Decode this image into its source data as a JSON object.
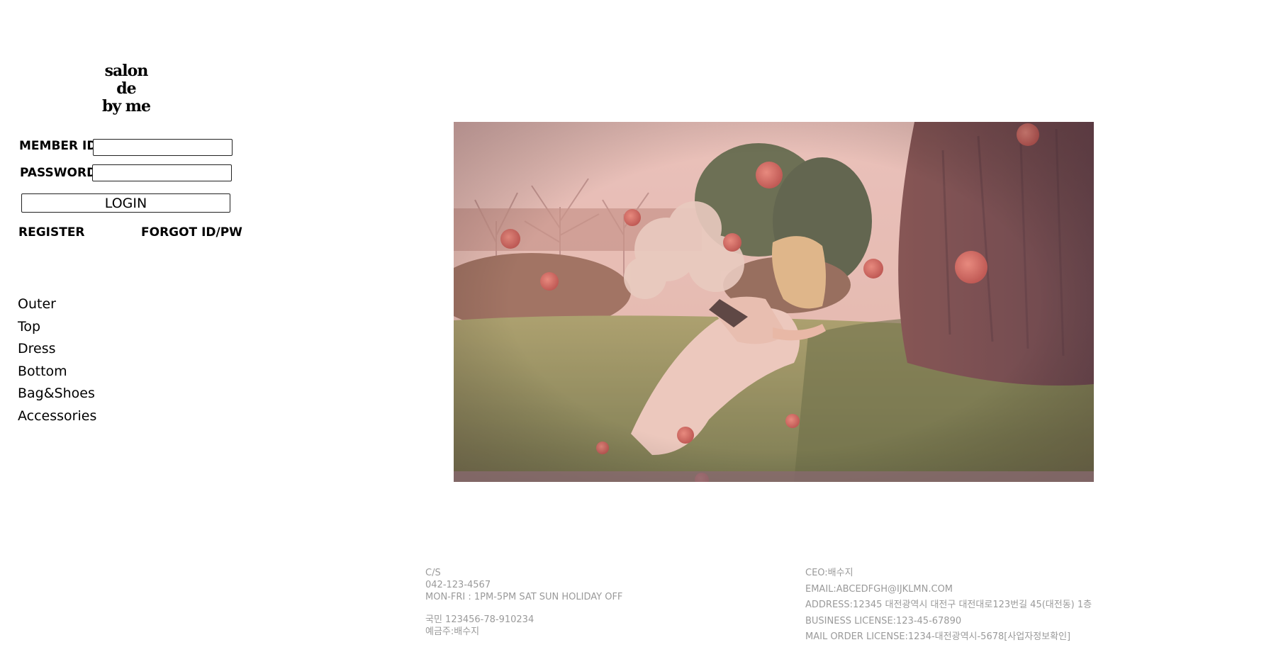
{
  "brand": {
    "line1": "salon de",
    "line2": "by me"
  },
  "login": {
    "member_id_label": "MEMBER ID",
    "password_label": "PASSWORD",
    "member_id_value": "",
    "password_value": "",
    "login_button": "LOGIN",
    "register_link": "REGISTER",
    "forgot_link": "FORGOT ID/PW"
  },
  "nav": {
    "items": [
      {
        "label": "Outer"
      },
      {
        "label": "Top"
      },
      {
        "label": "Dress"
      },
      {
        "label": "Bottom"
      },
      {
        "label": "Bag&Shoes"
      },
      {
        "label": "Accessories"
      }
    ]
  },
  "hero": {
    "alt": "Woman in a pink dress reading under a tree with floating apples"
  },
  "footer": {
    "cs": {
      "title": "C/S",
      "phone": "042-123-4567",
      "hours": "MON-FRI : 1PM-5PM SAT SUN HOLIDAY OFF",
      "bank": "국민 123456-78-910234",
      "holder": "예금주:배수지"
    },
    "company": {
      "ceo": "CEO:배수지",
      "email": "EMAIL:ABCEDFGH@IJKLMN.COM",
      "address": "ADDRESS:12345 대전광역시 대전구 대전대로123번길 45(대전동) 1층",
      "business_license": "BUSINESS LICENSE:123-45-67890",
      "mail_order_license": "MAIL ORDER LICENSE:1234-대전광역시-5678[사업자정보확인]"
    }
  },
  "colors": {
    "text": "#000000",
    "footer_text": "#9a9a9a",
    "photo_tint": "#c48a8a"
  }
}
